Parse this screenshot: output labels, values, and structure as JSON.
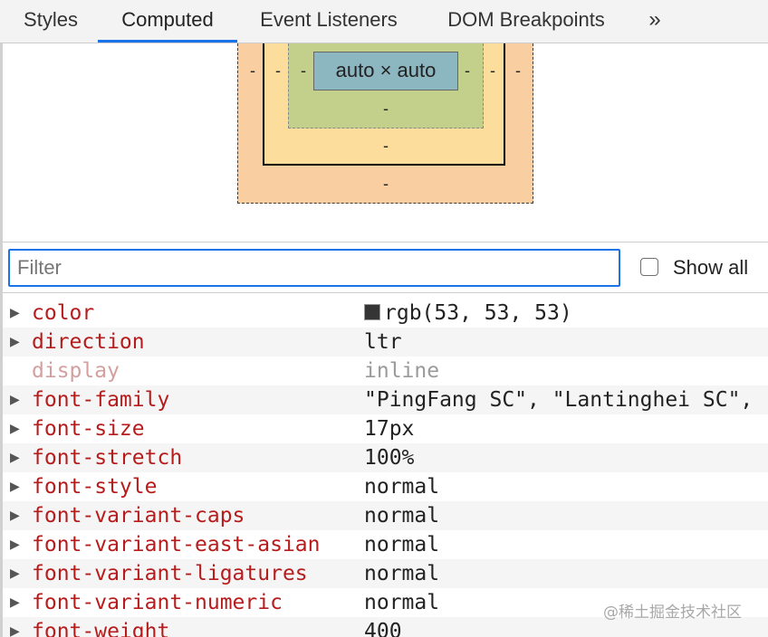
{
  "tabs": [
    {
      "label": "Styles",
      "active": false
    },
    {
      "label": "Computed",
      "active": true
    },
    {
      "label": "Event Listeners",
      "active": false
    },
    {
      "label": "DOM Breakpoints",
      "active": false
    }
  ],
  "tabs_more_glyph": "»",
  "box_model": {
    "content_label": "auto × auto",
    "margin_left": "-",
    "margin_right": "-",
    "margin_bottom": "-",
    "border_left": "-",
    "border_right": "-",
    "border_bottom": "-",
    "padding_left": "-",
    "padding_right": "-",
    "padding_bottom": "-",
    "colors": {
      "margin": "#f9cc9d",
      "border": "#fddd9b",
      "padding": "#c3d08b",
      "content": "#8cb6c0"
    }
  },
  "filter": {
    "placeholder": "Filter",
    "value": ""
  },
  "show_all": {
    "label": "Show all",
    "checked": false
  },
  "properties": [
    {
      "name": "color",
      "value": "rgb(53, 53, 53)",
      "swatch": "#353535",
      "inherited": false
    },
    {
      "name": "direction",
      "value": "ltr",
      "inherited": false
    },
    {
      "name": "display",
      "value": "inline",
      "inherited": true
    },
    {
      "name": "font-family",
      "value": "\"PingFang SC\", \"Lantinghei SC\",",
      "inherited": false
    },
    {
      "name": "font-size",
      "value": "17px",
      "inherited": false
    },
    {
      "name": "font-stretch",
      "value": "100%",
      "inherited": false
    },
    {
      "name": "font-style",
      "value": "normal",
      "inherited": false
    },
    {
      "name": "font-variant-caps",
      "value": "normal",
      "inherited": false
    },
    {
      "name": "font-variant-east-asian",
      "value": "normal",
      "inherited": false
    },
    {
      "name": "font-variant-ligatures",
      "value": "normal",
      "inherited": false
    },
    {
      "name": "font-variant-numeric",
      "value": "normal",
      "inherited": false
    },
    {
      "name": "font-weight",
      "value": "400",
      "inherited": false
    }
  ],
  "watermark": "@稀土掘金技术社区"
}
